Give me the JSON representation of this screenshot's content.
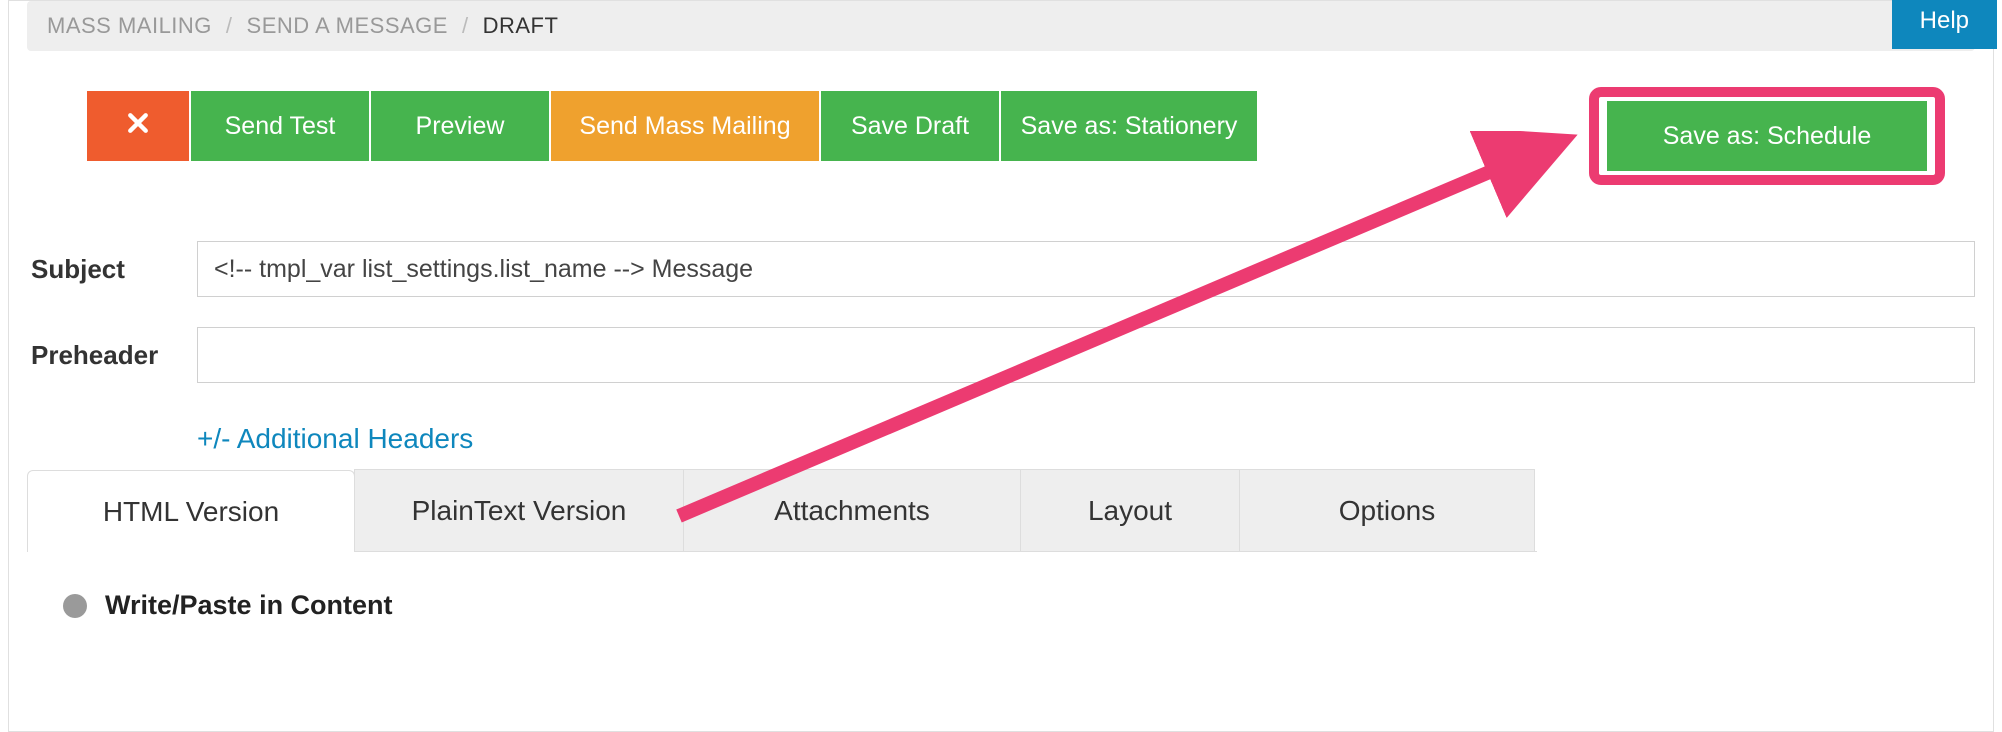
{
  "breadcrumb": {
    "items": [
      "MASS MAILING",
      "SEND A MESSAGE",
      "DRAFT"
    ],
    "separator": "/"
  },
  "help_label": "Help",
  "actions": {
    "send_test": "Send Test",
    "preview": "Preview",
    "send_mass_mailing": "Send Mass Mailing",
    "save_draft": "Save Draft",
    "save_stationery": "Save as: Stationery",
    "save_schedule": "Save as: Schedule"
  },
  "form": {
    "subject_label": "Subject",
    "subject_value": "<!-- tmpl_var list_settings.list_name --> Message",
    "preheader_label": "Preheader",
    "preheader_value": "",
    "additional_headers_link": "+/- Additional Headers"
  },
  "tabs": {
    "html": "HTML Version",
    "plaintext": "PlainText Version",
    "attachments": "Attachments",
    "layout": "Layout",
    "options": "Options"
  },
  "content": {
    "write_paste_label": "Write/Paste in Content"
  },
  "annotation": {
    "color": "#ec3b71",
    "target": "save-schedule-button"
  }
}
